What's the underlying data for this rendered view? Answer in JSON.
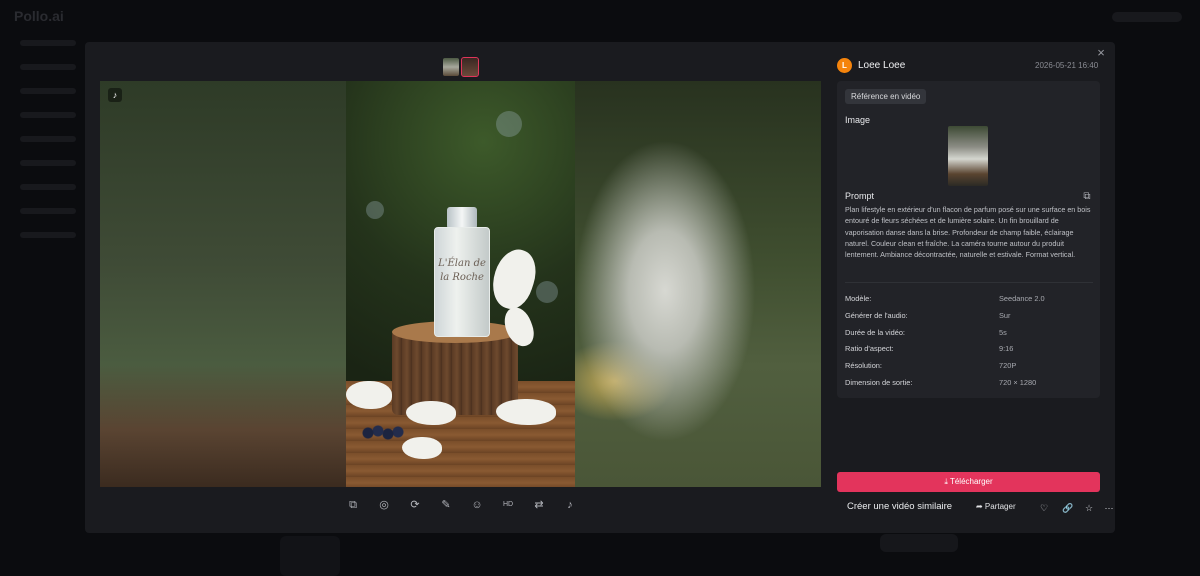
{
  "background_app": {
    "logo": "Pollo.ai"
  },
  "modal": {
    "close_label": "×",
    "viewer": {
      "tiktok_badge": "♪",
      "bottle_label": "L'Élan de la Roche"
    },
    "toolbar": {
      "tools": [
        {
          "icon": "video-icon",
          "glyph": "⧉"
        },
        {
          "icon": "lips-icon",
          "glyph": "◎"
        },
        {
          "icon": "refresh-icon",
          "glyph": "⟳"
        },
        {
          "icon": "edit-icon",
          "glyph": "✎"
        },
        {
          "icon": "face-swap-icon",
          "glyph": "☺"
        },
        {
          "icon": "hd-icon",
          "glyph": "HD"
        },
        {
          "icon": "adjust-icon",
          "glyph": "⇄"
        },
        {
          "icon": "tiktok-icon",
          "glyph": "♪"
        }
      ]
    },
    "author": {
      "initial": "L",
      "name": "Loee Loee",
      "date": "2026-05-21 16:40"
    },
    "info": {
      "tag": "Référence en vidéo",
      "image_heading": "Image",
      "prompt_heading": "Prompt",
      "prompt_text": "Plan lifestyle en extérieur d'un flacon de parfum posé sur une surface en bois entouré de fleurs séchées et de lumière solaire. Un fin brouillard de vaporisation danse dans la brise. Profondeur de champ faible, éclairage naturel. Couleur clean et fraîche. La caméra tourne autour du produit lentement. Ambiance décontractée, naturelle et estivale. Format vertical.",
      "specs": [
        {
          "key": "Modèle:",
          "value": "Seedance 2.0"
        },
        {
          "key": "Générer de l'audio:",
          "value": "Sur"
        },
        {
          "key": "Durée de la vidéo:",
          "value": "5s"
        },
        {
          "key": "Ratio d'aspect:",
          "value": "9:16"
        },
        {
          "key": "Résolution:",
          "value": "720P"
        },
        {
          "key": "Dimension de sortie:",
          "value": "720 × 1280"
        }
      ]
    },
    "download_label": "⤓  Télécharger",
    "similar_label": "Créer une vidéo similaire",
    "share_label": "➦  Partager",
    "colors": {
      "accent": "#e3345c",
      "avatar": "#f5840c",
      "panel": "#1a1b1f"
    }
  }
}
